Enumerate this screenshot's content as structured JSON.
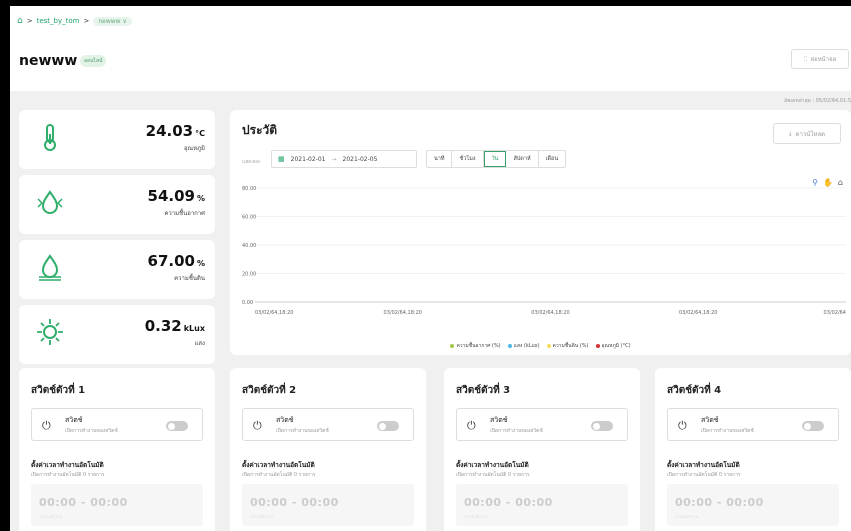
{
  "breadcrumb": {
    "project": "test_by_tom",
    "current": "newww"
  },
  "header": {
    "title": "newww",
    "status": "ออนไลน์",
    "home_button": "ย่อหน้าจอ",
    "updated": "อัพเดทล่าสุด : 05/02/64,01:5"
  },
  "sensors": [
    {
      "value": "24.03",
      "unit": "°C",
      "label": "อุณหภูมิ",
      "icon": "thermometer-icon"
    },
    {
      "value": "54.09",
      "unit": "%",
      "label": "ความชื้นอากาศ",
      "icon": "humidity-icon"
    },
    {
      "value": "67.00",
      "unit": "%",
      "label": "ความชื้นดิน",
      "icon": "soil-moisture-icon"
    },
    {
      "value": "0.32",
      "unit": "kLux",
      "label": "แสง",
      "icon": "sun-icon"
    }
  ],
  "history": {
    "title": "ประวัติ",
    "download": "ดาวน์โหลด",
    "show_label": "แสดงผล",
    "date_from": "2021-02-01",
    "date_sep": "→",
    "date_to": "2021-02-05",
    "tabs": [
      "นาที",
      "ชั่วโมง",
      "วัน",
      "สัปดาห์",
      "เดือน"
    ],
    "active_tab": 2
  },
  "chart_data": {
    "type": "line",
    "y_ticks": [
      "80.00",
      "60.00",
      "40.00",
      "20.00",
      "0.00"
    ],
    "ylim": [
      0,
      80
    ],
    "x_ticks": [
      "03/02/64,18:20",
      "03/02/64,18:20",
      "03/02/64,18:20",
      "03/02/64,18:20",
      "03/02/64"
    ],
    "series": [
      {
        "name": "ความชื้นอากาศ (%)",
        "color": "#a0c846"
      },
      {
        "name": "แสง (kLux)",
        "color": "#4bb8e0"
      },
      {
        "name": "ความชื้นดิน (%)",
        "color": "#f5dc5a"
      },
      {
        "name": "อุณหภูมิ (°C)",
        "color": "#d9303a"
      }
    ],
    "grid": true,
    "legend": "bottom"
  },
  "switches": [
    {
      "title": "สวิตช์ตัวที่ 1",
      "name": "สวิตช์",
      "desc": "เปิดการทำงานของสวิตช์",
      "sched_title": "ตั้งค่าเวลาทำงานอัตโนมัติ",
      "sched_sub": "เปิดการทำงานอัตโนมัติ 0 รายการ",
      "time": "00:00 - 00:00",
      "time_sub": "รายวันทำงาน"
    },
    {
      "title": "สวิตช์ตัวที่ 2",
      "name": "สวิตช์",
      "desc": "เปิดการทำงานของสวิตช์",
      "sched_title": "ตั้งค่าเวลาทำงานอัตโนมัติ",
      "sched_sub": "เปิดการทำงานอัตโนมัติ 0 รายการ",
      "time": "00:00 - 00:00",
      "time_sub": "รายวันทำงาน"
    },
    {
      "title": "สวิตช์ตัวที่ 3",
      "name": "สวิตช์",
      "desc": "เปิดการทำงานของสวิตช์",
      "sched_title": "ตั้งค่าเวลาทำงานอัตโนมัติ",
      "sched_sub": "เปิดการทำงานอัตโนมัติ 0 รายการ",
      "time": "00:00 - 00:00",
      "time_sub": "รายวันทำงาน"
    },
    {
      "title": "สวิตช์ตัวที่ 4",
      "name": "สวิตช์",
      "desc": "เปิดการทำงานของสวิตช์",
      "sched_title": "ตั้งค่าเวลาทำงานอัตโนมัติ",
      "sched_sub": "เปิดการทำงานอัตโนมัติ 0 รายการ",
      "time": "00:00 - 00:00",
      "time_sub": "รายวันทำงาน"
    }
  ]
}
